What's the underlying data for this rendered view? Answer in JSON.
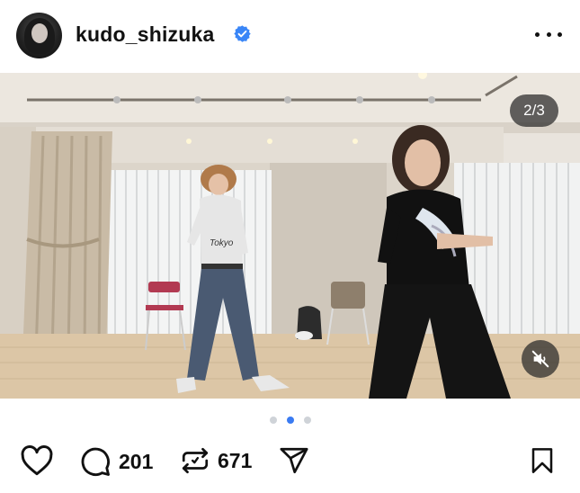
{
  "header": {
    "username": "kudo_shizuka",
    "verified_icon": "verified-badge-icon",
    "more_icon": "more-options-icon"
  },
  "media": {
    "counter": "2/3",
    "mute_icon": "speaker-muted-icon",
    "image_description_icon": "video-frame"
  },
  "carousel": {
    "total": 3,
    "active_index": 1
  },
  "actions": {
    "like_icon": "heart-icon",
    "comment_icon": "comment-icon",
    "comment_count": "201",
    "repost_icon": "repost-icon",
    "repost_count": "671",
    "share_icon": "share-icon",
    "save_icon": "bookmark-icon"
  },
  "colors": {
    "accent": "#3a7bf2",
    "verified": "#3a86f7",
    "overlay": "#282828"
  }
}
